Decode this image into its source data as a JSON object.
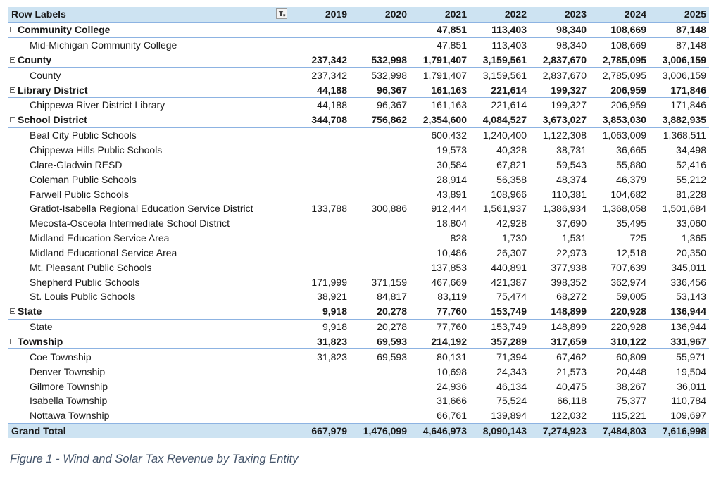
{
  "table": {
    "header": {
      "row_labels": "Row Labels",
      "years": [
        "2019",
        "2020",
        "2021",
        "2022",
        "2023",
        "2024",
        "2025"
      ]
    },
    "groups": [
      {
        "name": "Community College",
        "totals": [
          "",
          "",
          "47,851",
          "113,403",
          "98,340",
          "108,669",
          "87,148"
        ],
        "items": [
          {
            "name": "Mid-Michigan Community College",
            "values": [
              "",
              "",
              "47,851",
              "113,403",
              "98,340",
              "108,669",
              "87,148"
            ]
          }
        ]
      },
      {
        "name": "County",
        "totals": [
          "237,342",
          "532,998",
          "1,791,407",
          "3,159,561",
          "2,837,670",
          "2,785,095",
          "3,006,159"
        ],
        "items": [
          {
            "name": "County",
            "values": [
              "237,342",
              "532,998",
              "1,791,407",
              "3,159,561",
              "2,837,670",
              "2,785,095",
              "3,006,159"
            ]
          }
        ]
      },
      {
        "name": "Library District",
        "totals": [
          "44,188",
          "96,367",
          "161,163",
          "221,614",
          "199,327",
          "206,959",
          "171,846"
        ],
        "items": [
          {
            "name": "Chippewa River District Library",
            "values": [
              "44,188",
              "96,367",
              "161,163",
              "221,614",
              "199,327",
              "206,959",
              "171,846"
            ]
          }
        ]
      },
      {
        "name": "School District",
        "totals": [
          "344,708",
          "756,862",
          "2,354,600",
          "4,084,527",
          "3,673,027",
          "3,853,030",
          "3,882,935"
        ],
        "items": [
          {
            "name": "Beal City Public Schools",
            "values": [
              "",
              "",
              "600,432",
              "1,240,400",
              "1,122,308",
              "1,063,009",
              "1,368,511"
            ]
          },
          {
            "name": "Chippewa Hills Public Schools",
            "values": [
              "",
              "",
              "19,573",
              "40,328",
              "38,731",
              "36,665",
              "34,498"
            ]
          },
          {
            "name": "Clare-Gladwin RESD",
            "values": [
              "",
              "",
              "30,584",
              "67,821",
              "59,543",
              "55,880",
              "52,416"
            ]
          },
          {
            "name": "Coleman Public Schools",
            "values": [
              "",
              "",
              "28,914",
              "56,358",
              "48,374",
              "46,379",
              "55,212"
            ]
          },
          {
            "name": "Farwell Public Schools",
            "values": [
              "",
              "",
              "43,891",
              "108,966",
              "110,381",
              "104,682",
              "81,228"
            ]
          },
          {
            "name": "Gratiot-Isabella Regional Education Service District",
            "values": [
              "133,788",
              "300,886",
              "912,444",
              "1,561,937",
              "1,386,934",
              "1,368,058",
              "1,501,684"
            ]
          },
          {
            "name": "Mecosta-Osceola Intermediate School District",
            "values": [
              "",
              "",
              "18,804",
              "42,928",
              "37,690",
              "35,495",
              "33,060"
            ]
          },
          {
            "name": "Midland Education Service Area",
            "values": [
              "",
              "",
              "828",
              "1,730",
              "1,531",
              "725",
              "1,365"
            ]
          },
          {
            "name": "Midland Educational Service Area",
            "values": [
              "",
              "",
              "10,486",
              "26,307",
              "22,973",
              "12,518",
              "20,350"
            ]
          },
          {
            "name": "Mt. Pleasant Public Schools",
            "values": [
              "",
              "",
              "137,853",
              "440,891",
              "377,938",
              "707,639",
              "345,011"
            ]
          },
          {
            "name": "Shepherd Public Schools",
            "values": [
              "171,999",
              "371,159",
              "467,669",
              "421,387",
              "398,352",
              "362,974",
              "336,456"
            ]
          },
          {
            "name": "St. Louis Public Schools",
            "values": [
              "38,921",
              "84,817",
              "83,119",
              "75,474",
              "68,272",
              "59,005",
              "53,143"
            ]
          }
        ]
      },
      {
        "name": "State",
        "totals": [
          "9,918",
          "20,278",
          "77,760",
          "153,749",
          "148,899",
          "220,928",
          "136,944"
        ],
        "items": [
          {
            "name": "State",
            "values": [
              "9,918",
              "20,278",
              "77,760",
              "153,749",
              "148,899",
              "220,928",
              "136,944"
            ]
          }
        ]
      },
      {
        "name": "Township",
        "totals": [
          "31,823",
          "69,593",
          "214,192",
          "357,289",
          "317,659",
          "310,122",
          "331,967"
        ],
        "items": [
          {
            "name": "Coe Township",
            "values": [
              "31,823",
              "69,593",
              "80,131",
              "71,394",
              "67,462",
              "60,809",
              "55,971"
            ]
          },
          {
            "name": "Denver Township",
            "values": [
              "",
              "",
              "10,698",
              "24,343",
              "21,573",
              "20,448",
              "19,504"
            ]
          },
          {
            "name": "Gilmore Township",
            "values": [
              "",
              "",
              "24,936",
              "46,134",
              "40,475",
              "38,267",
              "36,011"
            ]
          },
          {
            "name": "Isabella Township",
            "values": [
              "",
              "",
              "31,666",
              "75,524",
              "66,118",
              "75,377",
              "110,784"
            ]
          },
          {
            "name": "Nottawa Township",
            "values": [
              "",
              "",
              "66,761",
              "139,894",
              "122,032",
              "115,221",
              "109,697"
            ]
          }
        ]
      }
    ],
    "grand_total": {
      "label": "Grand Total",
      "values": [
        "667,979",
        "1,476,099",
        "4,646,973",
        "8,090,143",
        "7,274,923",
        "7,484,803",
        "7,616,998"
      ]
    }
  },
  "caption": "Figure 1 - Wind and Solar Tax Revenue by Taxing Entity",
  "colors": {
    "header_fill": "#cde3f2",
    "rule": "#8db3e2",
    "caption": "#44546a"
  },
  "icons": {
    "filter": "filter-icon",
    "collapse": "collapse-minus-icon"
  }
}
